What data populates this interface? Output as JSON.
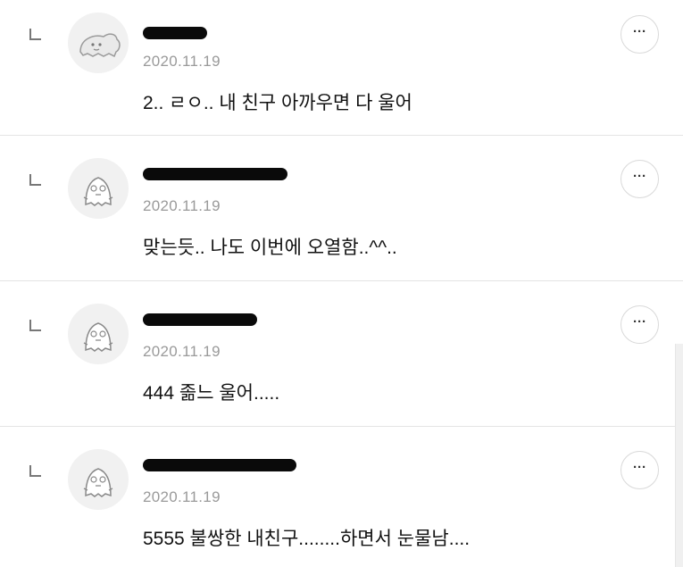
{
  "comments": [
    {
      "avatar_icon": "dinosaur-avatar-icon",
      "author_redacted": true,
      "date": "2020.11.19",
      "text": "2.. ㄹㅇ.. 내 친구 아까우면 다 울어",
      "more_label": "···"
    },
    {
      "avatar_icon": "default-character-avatar-icon",
      "author_redacted": true,
      "date": "2020.11.19",
      "text": "맞는듯.. 나도 이번에 오열함..^^..",
      "more_label": "···"
    },
    {
      "avatar_icon": "default-character-avatar-icon",
      "author_redacted": true,
      "date": "2020.11.19",
      "text": "444 졺느 울어.....",
      "more_label": "···"
    },
    {
      "avatar_icon": "default-character-avatar-icon",
      "author_redacted": true,
      "date": "2020.11.19",
      "text": "5555 불쌍한 내친구........하면서 눈물남....",
      "more_label": "···"
    }
  ],
  "colors": {
    "divider": "#e4e4e4",
    "date_text": "#9a9a9a",
    "body_text": "#111111",
    "avatar_bg": "#f1f1f1",
    "redaction": "#0a0a0a"
  }
}
